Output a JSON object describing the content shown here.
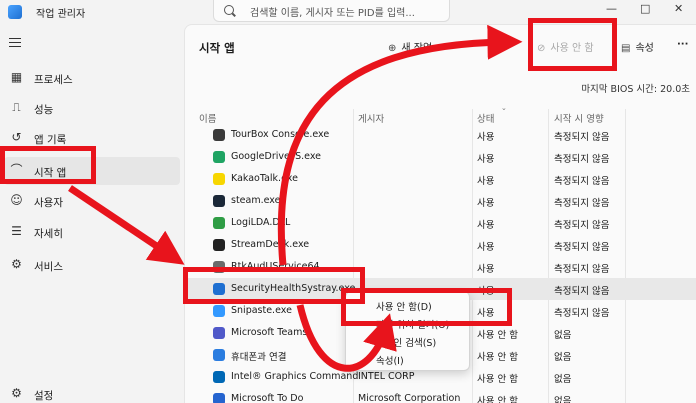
{
  "window": {
    "title": "작업 관리자",
    "search_placeholder": "검색할 이름, 게시자 또는 PID를 입력...",
    "controls": [
      "—",
      "□",
      "✕"
    ]
  },
  "sidebar": {
    "items": [
      {
        "label": "프로세스",
        "icon": "processes-icon",
        "glyph": "▦"
      },
      {
        "label": "성능",
        "icon": "performance-icon",
        "glyph": "⎍"
      },
      {
        "label": "앱 기록",
        "icon": "app-history-icon",
        "glyph": "↺"
      },
      {
        "label": "시작 앱",
        "icon": "startup-apps-icon",
        "glyph": "⌒"
      },
      {
        "label": "사용자",
        "icon": "users-icon",
        "glyph": "☺"
      },
      {
        "label": "자세히",
        "icon": "details-icon",
        "glyph": "☰"
      },
      {
        "label": "서비스",
        "icon": "services-icon",
        "glyph": "⚙"
      }
    ],
    "settings_label": "설정"
  },
  "toolbar": {
    "page_title": "시작 앱",
    "new_task_label": "새 작업",
    "disable_label": "사용 안 함",
    "properties_label": "속성",
    "more": "···"
  },
  "bios_time": "마지막 BIOS 시간:  20.0초",
  "columns": {
    "name": "이름",
    "publisher": "게시자",
    "status": "상태",
    "impact": "시작 시 영향"
  },
  "rows": [
    {
      "name": "TourBox Console.exe",
      "publisher": "",
      "status": "사용",
      "impact": "측정되지 않음",
      "color": "#3a3a3a"
    },
    {
      "name": "GoogleDriveFS.exe",
      "publisher": "",
      "status": "사용",
      "impact": "측정되지 않음",
      "color": "#1fa463"
    },
    {
      "name": "KakaoTalk.exe",
      "publisher": "",
      "status": "사용",
      "impact": "측정되지 않음",
      "color": "#f7d600"
    },
    {
      "name": "steam.exe",
      "publisher": "",
      "status": "사용",
      "impact": "측정되지 않음",
      "color": "#1b2838"
    },
    {
      "name": "LogiLDA.DLL",
      "publisher": "",
      "status": "사용",
      "impact": "측정되지 않음",
      "color": "#2f9d45"
    },
    {
      "name": "StreamDeck.exe",
      "publisher": "",
      "status": "사용",
      "impact": "측정되지 않음",
      "color": "#222222"
    },
    {
      "name": "RtkAudUService64",
      "publisher": "",
      "status": "사용",
      "impact": "측정되지 않음",
      "color": "#6b6b6b"
    },
    {
      "name": "SecurityHealthSystray.exe",
      "publisher": "",
      "status": "사용",
      "impact": "측정되지 않음",
      "color": "#1e6fd1"
    },
    {
      "name": "Snipaste.exe",
      "publisher": "",
      "status": "사용",
      "impact": "측정되지 않음",
      "color": "#3399ff"
    },
    {
      "name": "Microsoft Teams",
      "publisher": "",
      "status": "사용 안 함",
      "impact": "없음",
      "color": "#5059c9"
    },
    {
      "name": "휴대폰과 연결",
      "publisher": "",
      "status": "사용 안 함",
      "impact": "없음",
      "color": "#2b7de0"
    },
    {
      "name": "Intel® Graphics Command",
      "publisher": "INTEL CORP",
      "status": "사용 안 함",
      "impact": "없음",
      "color": "#0068b5"
    },
    {
      "name": "Microsoft To Do",
      "publisher": "Microsoft Corporation",
      "status": "사용 안 함",
      "impact": "없음",
      "color": "#2564cf"
    }
  ],
  "context_menu": {
    "items": [
      "사용 안 함(D)",
      "파일 위치 열기(O)",
      "온라인 검색(S)",
      "속성(I)"
    ]
  },
  "annotation_color": "#e8141c"
}
